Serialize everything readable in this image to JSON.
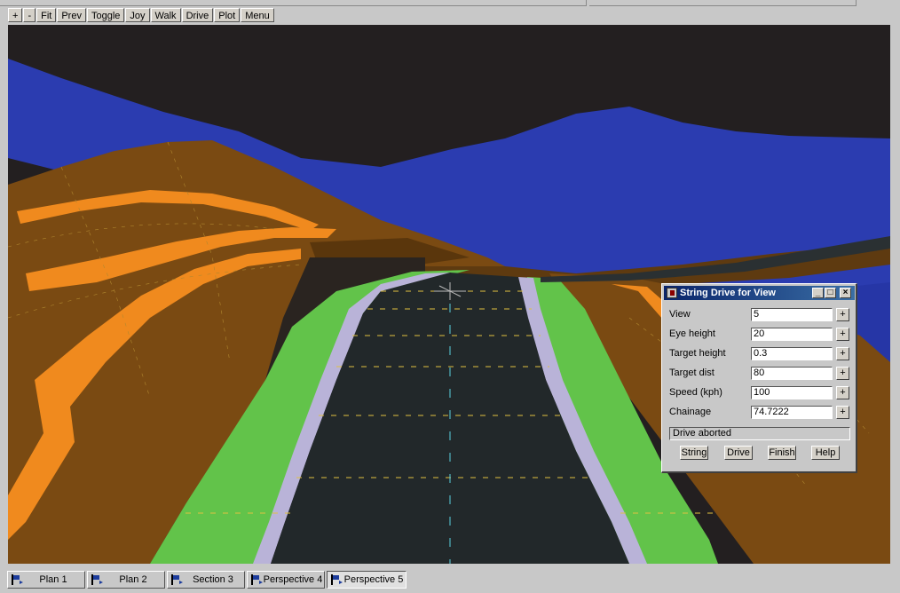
{
  "toolbar": {
    "buttons": [
      "+",
      "-",
      "Fit",
      "Prev",
      "Toggle",
      "Joy",
      "Walk",
      "Drive",
      "Plot",
      "Menu"
    ]
  },
  "dialog": {
    "title": "String Drive for View",
    "fields": [
      {
        "label": "View",
        "value": "5"
      },
      {
        "label": "Eye height",
        "value": "20"
      },
      {
        "label": "Target height",
        "value": "0.3"
      },
      {
        "label": "Target dist",
        "value": "80"
      },
      {
        "label": "Speed (kph)",
        "value": "100"
      },
      {
        "label": "Chainage",
        "value": "74.7222"
      }
    ],
    "field_button": "+",
    "status": "Drive aborted",
    "buttons": [
      "String",
      "Drive",
      "Finish",
      "Help"
    ],
    "window_controls": [
      "_",
      "□",
      "×"
    ]
  },
  "taskbar": {
    "items": [
      {
        "label": "Plan 1",
        "active": false
      },
      {
        "label": "Plan 2",
        "active": false
      },
      {
        "label": "Section 3",
        "active": false
      },
      {
        "label": "Perspective 4",
        "active": false
      },
      {
        "label": "Perspective 5",
        "active": true
      }
    ]
  },
  "colors": {
    "sky": "#231f20",
    "water": "#2b3cb0",
    "terrain": "#7a4a12",
    "cut_band": "#f08a1e",
    "verge": "#62c34a",
    "road": "#22282a",
    "kerb": "#b9b3d8",
    "dialog_title": "#0a246a"
  }
}
